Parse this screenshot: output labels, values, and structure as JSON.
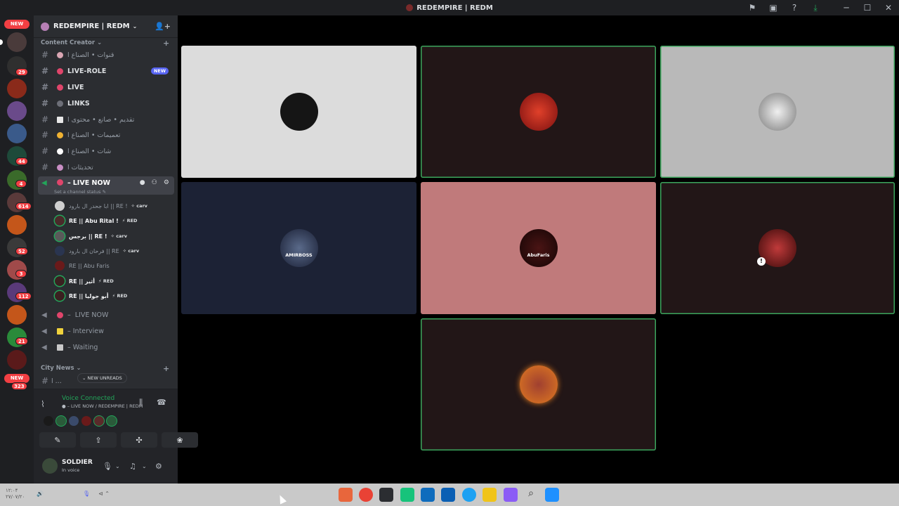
{
  "window": {
    "title": "REDEMPIRE | REDM",
    "controls": [
      "flag-icon",
      "inbox-icon",
      "help-icon",
      "download-icon",
      "minimize-icon",
      "maximize-icon",
      "close-icon"
    ],
    "controls_glyphs": [
      "⚑",
      "▣",
      "?",
      "⤓",
      "─",
      "☐",
      "✕"
    ]
  },
  "server_rail": {
    "new_top": "NEW",
    "new_bottom": "NEW",
    "badges": [
      "29",
      "44",
      "4",
      "614",
      "52",
      "3",
      "112",
      "21",
      "323"
    ]
  },
  "guild": {
    "name": "REDEMPIRE | REDM",
    "chevron": "⌄",
    "invite_glyph": "👤+"
  },
  "categories": {
    "content_creator": "Content Creator",
    "city_news": "City News",
    "collapse_glyph": "⌄",
    "plus": "+"
  },
  "channels": [
    {
      "label": "قنوات • الصناع ا",
      "emoji_color": "#d9a6b3"
    },
    {
      "label": "LIVE-ROLE",
      "emoji_color": "#e0456b",
      "tag": "NEW"
    },
    {
      "label": "LIVE",
      "emoji_color": "#e0456b"
    },
    {
      "label": "LINKS",
      "emoji_color": "#6d6f78"
    },
    {
      "label": "تقديم • صانع • محتوى ا",
      "emoji_color": "#e8e8e8"
    },
    {
      "label": "تعميمات • الصناع ا",
      "emoji_color": "#f0b232"
    },
    {
      "label": "شات • الصناع ا",
      "emoji_color": "#ffffff"
    },
    {
      "label": "تحديثات ا",
      "emoji_color": "#c98fc4"
    }
  ],
  "active_voice": {
    "label": "LIVE NOW",
    "prefix": "–",
    "status_hint": "Set a channel status ✎",
    "icons": "● ⚇ ⚙",
    "members": [
      {
        "name": "ابا جحدر ال بارود || RE !",
        "tag": "✧ carv",
        "speaking": false,
        "color": "#cfcfcf"
      },
      {
        "name": "RE || Abu Rital !",
        "tag": "⚡ RED",
        "speaking": true,
        "color": "#4a2a2a"
      },
      {
        "name": "برجس || RE !",
        "tag": "✧ carv",
        "speaking": true,
        "color": "#5a5a5a"
      },
      {
        "name": "فرحان ال بارود || RE",
        "tag": "✧ carv",
        "speaking": false,
        "color": "#2a3550"
      },
      {
        "name": "RE || Abu Faris",
        "tag": "",
        "speaking": false,
        "color": "#6a1a1a"
      },
      {
        "name": "RE || أثير",
        "tag": "⚡ RED",
        "speaking": true,
        "color": "#3a2020"
      },
      {
        "name": "RE || أبو جوليا",
        "tag": "⚡ RED",
        "speaking": true,
        "color": "#3a2020"
      }
    ]
  },
  "voice_channels": [
    {
      "label": "LIVE NOW",
      "prefix": "–",
      "emoji_color": "#e0456b"
    },
    {
      "label": "Interview",
      "prefix": "–",
      "emoji_color": "#f0d23c"
    },
    {
      "label": "Waiting",
      "prefix": "–",
      "emoji_color": "#c9c9c9"
    }
  ],
  "city_news_channel": {
    "label": "ا ..."
  },
  "new_unreads": "⌄ NEW UNREADS",
  "voice_panel": {
    "title": "Voice Connected",
    "subtitle": "● – LIVE NOW / REDEMPIRE | REDM",
    "avatar_colors": [
      "#1a1a1a",
      "#2a5a3a",
      "#3a4a6a",
      "#6a1a1a",
      "#5a2a2a",
      "#2a5a3a"
    ],
    "buttons": [
      "✎",
      "⇪",
      "✣",
      "❀"
    ]
  },
  "user": {
    "name": "SOLDIER",
    "status": "In voice"
  },
  "tiles": [
    {
      "bg": "#dcdcdc",
      "avatar": "#151515",
      "speaking": false
    },
    {
      "bg": "#221617",
      "avatar": "#c0201c",
      "speaking": true
    },
    {
      "bg": "#b9b9b9",
      "avatar": "#dedede",
      "speaking": true
    },
    {
      "bg": "#1c2235",
      "avatar": "#34405e",
      "label": "AMIRBOSS",
      "speaking": false
    },
    {
      "bg": "#c07a7b",
      "avatar": "#2a0e0e",
      "label": "AbuFaris",
      "speaking": false
    },
    {
      "bg": "#221617",
      "avatar": "#8b1a1e",
      "muted": true,
      "speaking": true
    },
    {
      "bg": "#221617",
      "avatar": "#b3402a",
      "speaking": true
    }
  ],
  "taskbar": {
    "tray_time": "۱۲:۰۴\n۲۷/۰۷/۲۰",
    "tray_glyphs": "⊲ ⌃",
    "apps": [
      "#e8663c",
      "#e94235",
      "#2b2d31",
      "#17c37b",
      "#0f6cbd",
      "#0a5fb4",
      "#1da1f2",
      "#f0c419",
      "#8b5cf6",
      "#333333",
      "#1e90ff"
    ]
  }
}
